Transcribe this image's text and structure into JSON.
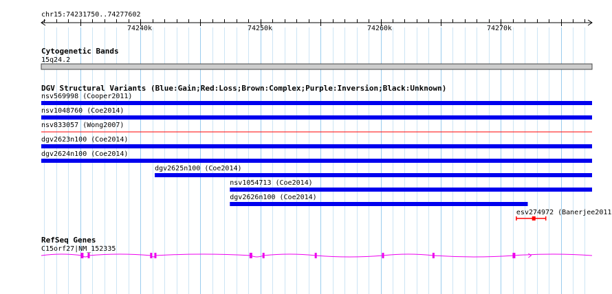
{
  "region": {
    "label": "chr15:74231750..74277602",
    "start": 74231750,
    "end": 74277602
  },
  "ruler": {
    "ticks": [
      "74240k",
      "74250k",
      "74260k",
      "74270k"
    ]
  },
  "colors": {
    "gain": "#0000ee",
    "loss": "#ff0000",
    "gene": "#ee00ee",
    "grid_major": "#99ccee",
    "grid_minor": "#cce4f4",
    "band_fill": "#cccccc",
    "band_border": "#444444"
  },
  "cytoband": {
    "title": "Cytogenetic Bands",
    "band": "15q24.2"
  },
  "dgv": {
    "title": "DGV Structural Variants (Blue:Gain;Red:Loss;Brown:Complex;Purple:Inversion;Black:Unknown)",
    "variants": [
      {
        "label": "nsv569998 (Cooper2011)",
        "type": "gain",
        "start": 74231750,
        "end": 74277602
      },
      {
        "label": "nsv1048760 (Coe2014)",
        "type": "gain",
        "start": 74231750,
        "end": 74277602
      },
      {
        "label": "nsv833057 (Wong2007)",
        "type": "loss",
        "start": 74231750,
        "end": 74277602
      },
      {
        "label": "dgv2623n100 (Coe2014)",
        "type": "gain",
        "start": 74231750,
        "end": 74277602
      },
      {
        "label": "dgv2624n100 (Coe2014)",
        "type": "gain",
        "start": 74231750,
        "end": 74277602
      },
      {
        "label": "dgv2625n100 (Coe2014)",
        "type": "gain",
        "start": 74241200,
        "end": 74277602
      },
      {
        "label": "nsv1054713 (Coe2014)",
        "type": "gain",
        "start": 74247450,
        "end": 74277602
      },
      {
        "label": "dgv2626n100 (Coe2014)",
        "type": "gain",
        "start": 74247450,
        "end": 74272250
      },
      {
        "label": "esv274972 (Banerjee2011)",
        "type": "loss",
        "start": 74271300,
        "end": 74273750,
        "style": "interval"
      }
    ]
  },
  "refseq": {
    "title": "RefSeq Genes",
    "gene": {
      "label": "C15orf27|NM_152335",
      "start": 74231750,
      "end": 74277602,
      "strand": "+",
      "exons": [
        74235150,
        74235700,
        74241250,
        74240900,
        74249200,
        74250250,
        74254600,
        74260200,
        74264400,
        74271100
      ]
    }
  }
}
